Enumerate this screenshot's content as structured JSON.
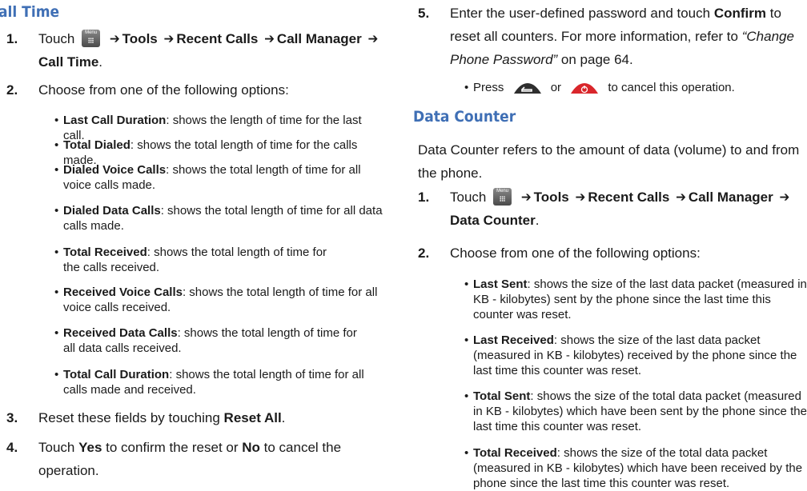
{
  "left": {
    "heading": "all Time",
    "step1": {
      "num": "1.",
      "touch": "Touch",
      "tools": "Tools",
      "recent_calls": "Recent Calls",
      "call_manager": "Call Manager",
      "call_time": "Call Time",
      "period": ".",
      "menu_key_label": "Menu"
    },
    "step2": {
      "num": "2.",
      "text": "Choose from one of the following options:"
    },
    "bullets": [
      {
        "term": "Last Call Duration",
        "desc": ": shows the length of time for the last call."
      },
      {
        "term": "Total Dialed",
        "desc": ": shows the total length of time for the calls made."
      },
      {
        "term": "Dialed Voice Calls",
        "desc": ": shows the total length of time for all voice calls made."
      },
      {
        "term": "Dialed Data Calls",
        "desc": ": shows the total length of time for all data calls made."
      },
      {
        "term": "Total Received",
        "desc": ": shows the total length of time for the calls received."
      },
      {
        "term": "Received Voice Calls",
        "desc": ": shows the total length of time for all voice calls received."
      },
      {
        "term": "Received Data Calls",
        "desc": ": shows the total length of time for all data calls received."
      },
      {
        "term": "Total Call Duration",
        "desc": ": shows the total length of time for all calls made and received."
      }
    ],
    "step3": {
      "num": "3.",
      "pre": "Reset these fields by touching",
      "bold": "Reset All",
      "post": "."
    },
    "step4": {
      "num": "4.",
      "pre": "Touch",
      "yes": "Yes",
      "mid": "to confirm the reset or",
      "no": "No",
      "post": "to cancel the operation."
    }
  },
  "right": {
    "step5": {
      "num": "5.",
      "pre": "Enter the user-defined password and touch",
      "confirm": "Confirm",
      "mid": "to reset all counters. For more information, refer to",
      "ref": "“Change Phone Password”",
      "post": "on page 64."
    },
    "press_bullet": {
      "pre": "Press",
      "or": "or",
      "post": "to cancel this operation."
    },
    "heading": "Data Counter",
    "intro": "Data Counter refers to the amount of data (volume) to and from the phone.",
    "step1": {
      "num": "1.",
      "touch": "Touch",
      "tools": "Tools",
      "recent_calls": "Recent Calls",
      "call_manager": "Call Manager",
      "data_counter": "Data Counter",
      "period": ".",
      "menu_key_label": "Menu"
    },
    "step2": {
      "num": "2.",
      "text": "Choose from one of the following options:"
    },
    "bullets": [
      {
        "term": "Last Sent",
        "desc": ": shows the size of the last data packet (measured in KB - kilobytes) sent by the phone since the last time this counter was reset."
      },
      {
        "term": "Last Received",
        "desc": ": shows the size of the last data packet (measured in KB - kilobytes) received by the phone since the last time this counter was reset."
      },
      {
        "term": "Total Sent",
        "desc": ": shows the size of the total data packet (measured in KB - kilobytes) which have been sent by the phone since the last time this counter was reset."
      },
      {
        "term": "Total Received",
        "desc": ": shows the size of the total data packet (measured in KB - kilobytes) which have been received by the phone since the last time this counter was reset."
      }
    ]
  },
  "colors": {
    "heading": "#3f6fb5",
    "text": "#1a1a1a",
    "end_key_red": "#d9262b",
    "back_key_dark": "#2e2e2e"
  },
  "icons": [
    "menu-key-icon",
    "arrow-right-icon",
    "back-key-icon",
    "end-key-icon"
  ]
}
